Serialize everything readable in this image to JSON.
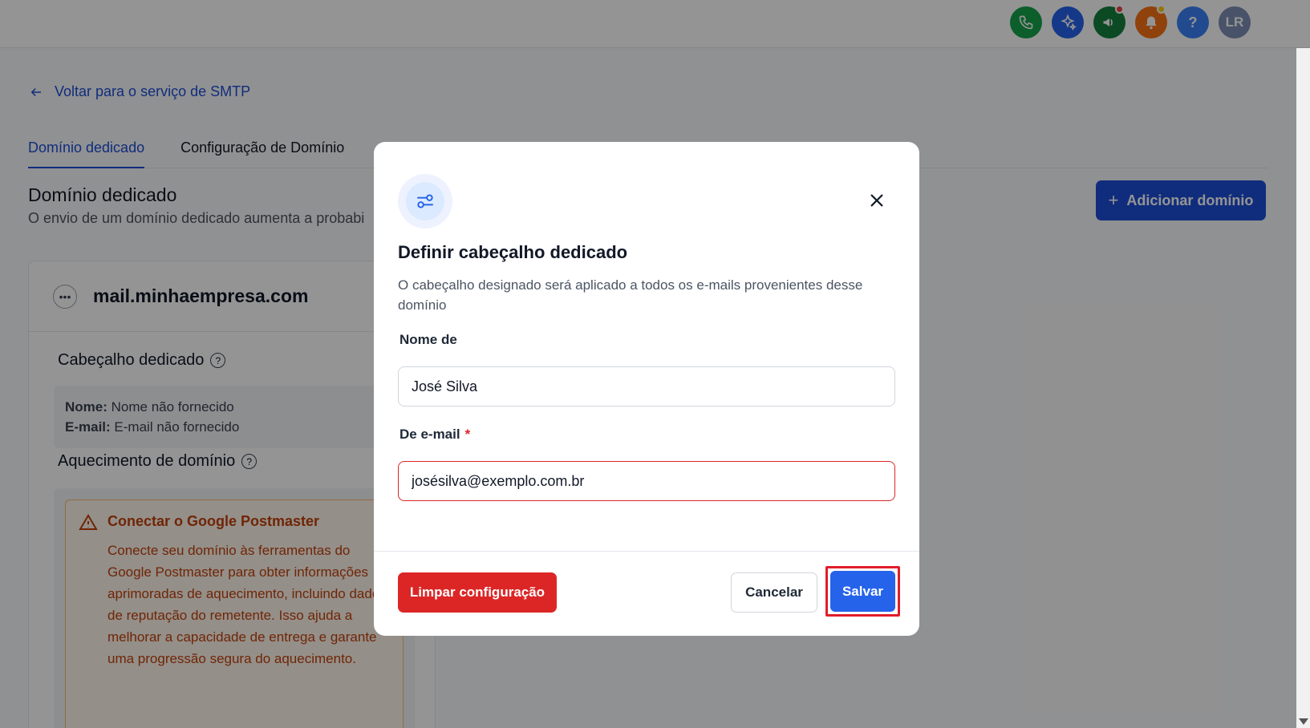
{
  "topbar": {
    "avatar_initials": "LR",
    "help_glyph": "?",
    "icons": [
      "phone-icon",
      "ai-sparkle-icon",
      "megaphone-icon",
      "bell-icon",
      "help-icon"
    ]
  },
  "page": {
    "back_link": "Voltar para o serviço de SMTP",
    "tabs": [
      {
        "label": "Domínio dedicado",
        "active": true
      },
      {
        "label": "Configuração de Domínio",
        "active": false
      }
    ],
    "section_title": "Domínio dedicado",
    "section_subtitle": "O envio de um domínio dedicado aumenta a probabi",
    "add_domain_button": "Adicionar domínio",
    "card": {
      "domain": "mail.minhaempresa.com",
      "header_title": "Cabeçalho dedicado",
      "name_label": "Nome:",
      "name_value": "Nome não fornecido",
      "email_label": "E-mail:",
      "email_value": "E-mail não fornecido",
      "warmup_title": "Aquecimento de domínio",
      "warning_title": "Conectar o Google Postmaster",
      "warning_text": "Conecte seu domínio às ferramentas do Google Postmaster para obter informações aprimoradas de aquecimento, incluindo dados de reputação do remetente. Isso ajuda a melhorar a capacidade de entrega e garante uma progressão segura do aquecimento."
    }
  },
  "modal": {
    "title": "Definir cabeçalho dedicado",
    "description": "O cabeçalho designado será aplicado a todos os e-mails provenientes desse domínio",
    "from_name_label": "Nome de",
    "from_name_value": "José Silva",
    "from_email_label": "De e-mail",
    "required_mark": "*",
    "from_email_value": "josésilva@exemplo.com.br",
    "clear_button": "Limpar configuração",
    "cancel_button": "Cancelar",
    "save_button": "Salvar"
  },
  "colors": {
    "primary": "#2563eb",
    "danger": "#dc2626",
    "highlight_frame": "#e11d2a",
    "warning": "#c2410c"
  }
}
